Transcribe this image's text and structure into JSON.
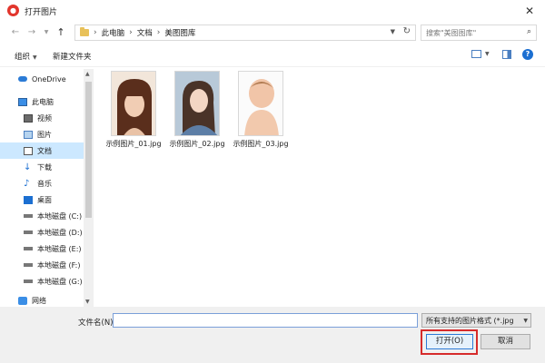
{
  "window": {
    "title": "打开图片",
    "app_icon": "app-logo-icon",
    "close_icon": "close-icon"
  },
  "address": {
    "back_icon": "back-arrow-icon",
    "forward_icon": "forward-arrow-icon",
    "up_icon": "up-arrow-icon",
    "breadcrumbs": [
      "此电脑",
      "文档",
      "美图图库"
    ],
    "search_placeholder": "搜索\"美图图库\""
  },
  "toolbar": {
    "organize_label": "组织",
    "new_folder_label": "新建文件夹"
  },
  "sidebar": {
    "items": [
      {
        "label": "OneDrive",
        "icon": "cloud-icon"
      },
      {
        "label": "此电脑",
        "icon": "computer-icon"
      },
      {
        "label": "视频",
        "icon": "video-icon"
      },
      {
        "label": "图片",
        "icon": "picture-icon"
      },
      {
        "label": "文档",
        "icon": "document-icon",
        "selected": true
      },
      {
        "label": "下载",
        "icon": "download-icon"
      },
      {
        "label": "音乐",
        "icon": "music-icon"
      },
      {
        "label": "桌面",
        "icon": "desktop-icon"
      },
      {
        "label": "本地磁盘 (C:)",
        "icon": "drive-icon"
      },
      {
        "label": "本地磁盘 (D:)",
        "icon": "drive-icon"
      },
      {
        "label": "本地磁盘 (E:)",
        "icon": "drive-icon"
      },
      {
        "label": "本地磁盘 (F:)",
        "icon": "drive-icon"
      },
      {
        "label": "本地磁盘 (G:)",
        "icon": "drive-icon"
      },
      {
        "label": "网络",
        "icon": "network-icon"
      }
    ]
  },
  "files": [
    {
      "name": "示例图片_01.jpg"
    },
    {
      "name": "示例图片_02.jpg"
    },
    {
      "name": "示例图片_03.jpg"
    }
  ],
  "bottom": {
    "filename_label": "文件名(N):",
    "filename_value": "",
    "filetype_value": "所有支持的图片格式 (*.jpg",
    "open_label": "打开(O)",
    "cancel_label": "取消"
  },
  "colors": {
    "accent": "#2c7ad6",
    "selection": "#cce8ff",
    "highlight_box": "#d62b2b"
  }
}
